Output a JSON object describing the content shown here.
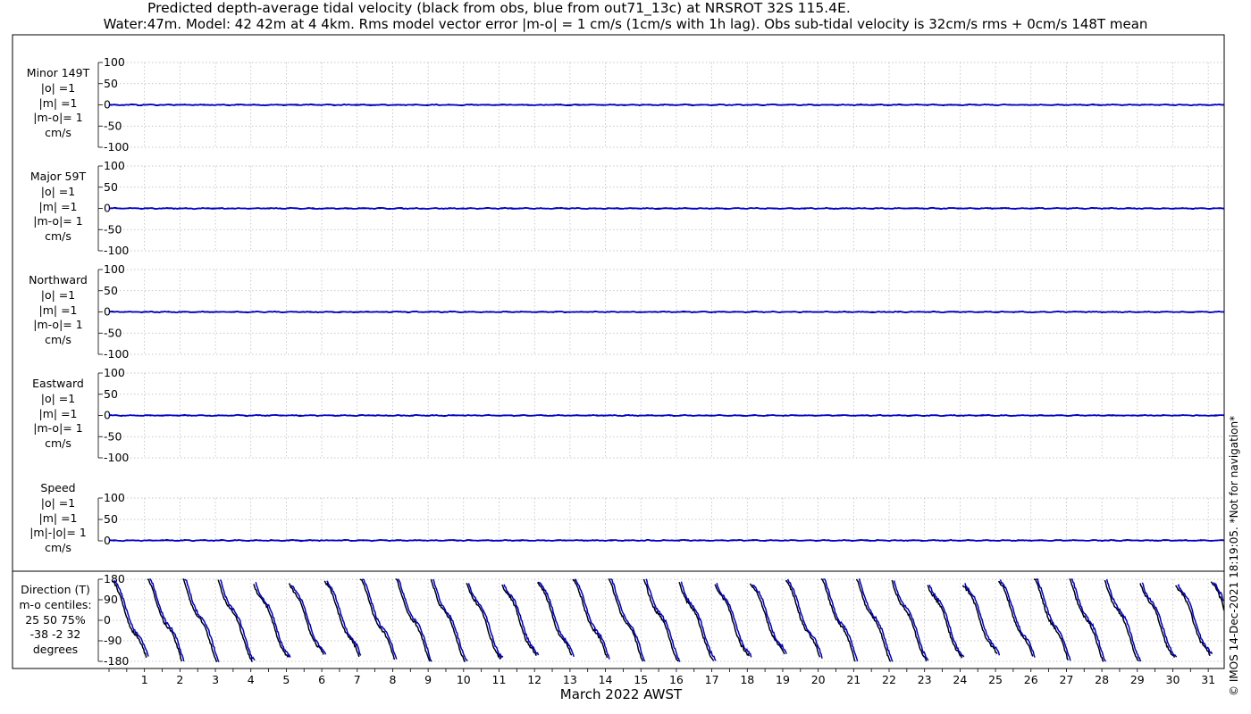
{
  "title": {
    "line1": "Predicted depth-average tidal velocity (black from obs, blue from out71_13c) at NRSROT 32S 115.4E.",
    "line2": "Water:47m. Model: 42 42m at 4 4km. Rms model vector error |m-o| = 1 cm/s (1cm/s with 1h lag). Obs sub-tidal velocity is 32cm/s rms + 0cm/s 148T mean"
  },
  "credit": "© IMOS 14-Dec-2021 18:19:05. *Not for navigation*",
  "colors": {
    "obs": "#000000",
    "model": "#0000c8",
    "grid": "#b4b4b4"
  },
  "chart_data": [
    {
      "type": "line",
      "panel": "minor",
      "label_lines": [
        "Minor 149T",
        "|o| =1",
        "|m| =1",
        "|m-o|= 1",
        "cm/s"
      ],
      "ylim": [
        -100,
        100
      ],
      "yticks": [
        -100,
        -50,
        0,
        50,
        100
      ],
      "series": [
        {
          "role": "obs",
          "values": "≈0 throughout"
        },
        {
          "role": "model",
          "values": "≈0 throughout"
        }
      ]
    },
    {
      "type": "line",
      "panel": "major",
      "label_lines": [
        "Major 59T",
        "|o| =1",
        "|m| =1",
        "|m-o|= 1",
        "cm/s"
      ],
      "ylim": [
        -100,
        100
      ],
      "yticks": [
        -100,
        -50,
        0,
        50,
        100
      ],
      "series": [
        {
          "role": "obs",
          "values": "≈0 throughout"
        },
        {
          "role": "model",
          "values": "≈0 throughout"
        }
      ]
    },
    {
      "type": "line",
      "panel": "northward",
      "label_lines": [
        "Northward",
        "|o| =1",
        "|m| =1",
        "|m-o|= 1",
        "cm/s"
      ],
      "ylim": [
        -100,
        100
      ],
      "yticks": [
        -100,
        -50,
        0,
        50,
        100
      ],
      "series": [
        {
          "role": "obs",
          "values": "≈0 throughout"
        },
        {
          "role": "model",
          "values": "≈0 throughout"
        }
      ]
    },
    {
      "type": "line",
      "panel": "eastward",
      "label_lines": [
        "Eastward",
        "|o| =1",
        "|m| =1",
        "|m-o|= 1",
        "cm/s"
      ],
      "ylim": [
        -100,
        100
      ],
      "yticks": [
        -100,
        -50,
        0,
        50,
        100
      ],
      "series": [
        {
          "role": "obs",
          "values": "≈0 throughout"
        },
        {
          "role": "model",
          "values": "≈0 throughout"
        }
      ]
    },
    {
      "type": "line",
      "panel": "speed",
      "label_lines": [
        "Speed",
        "|o| =1",
        "|m| =1",
        "|m|-|o|= 1",
        "cm/s"
      ],
      "ylim": [
        0,
        100
      ],
      "yticks": [
        0,
        50,
        100
      ],
      "series": [
        {
          "role": "obs",
          "values": "≈1 throughout"
        },
        {
          "role": "model",
          "values": "≈1 throughout"
        }
      ]
    },
    {
      "type": "line",
      "panel": "direction",
      "label_lines": [
        "Direction (T)",
        "m-o centiles:",
        "25  50  75%",
        "-38  -2  32",
        "degrees"
      ],
      "ylim": [
        -180,
        180
      ],
      "yticks": [
        -180,
        -90,
        0,
        90,
        180
      ],
      "series": [
        {
          "role": "obs",
          "note": "sawtooth, wrapping from +180 to -180 about once per day"
        },
        {
          "role": "model",
          "note": "sawtooth, wrapping from +180 to -180 about once per day"
        }
      ]
    }
  ],
  "x_axis": {
    "label": "March 2022 AWST",
    "xlim": [
      0,
      31.45
    ],
    "days": [
      "1",
      "2",
      "3",
      "4",
      "5",
      "6",
      "7",
      "8",
      "9",
      "10",
      "11",
      "12",
      "13",
      "14",
      "15",
      "16",
      "17",
      "18",
      "19",
      "20",
      "21",
      "22",
      "23",
      "24",
      "25",
      "26",
      "27",
      "28",
      "29",
      "30",
      "31"
    ]
  }
}
